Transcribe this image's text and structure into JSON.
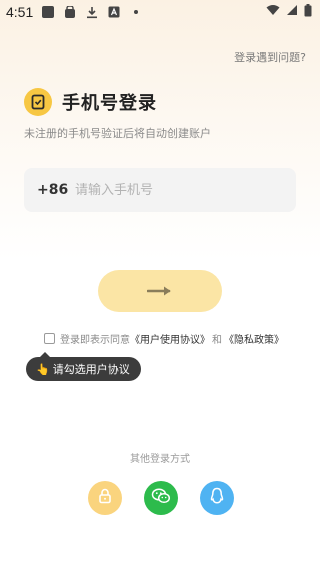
{
  "status_bar": {
    "time": "4:51",
    "icons": [
      "app-icon",
      "lock-app-icon",
      "download-icon",
      "font-app-icon",
      "dot-icon",
      "wifi-icon",
      "signal-icon",
      "battery-icon"
    ]
  },
  "header": {
    "help_link": "登录遇到问题?"
  },
  "title": {
    "text": "手机号登录",
    "logo_icon": "phone-check-icon"
  },
  "subtitle": "未注册的手机号验证后将自动创建账户",
  "phone": {
    "country_code": "+86",
    "placeholder": "请输入手机号",
    "value": ""
  },
  "submit": {
    "icon": "arrow-right-icon",
    "color": "#fbe5a5",
    "arrow_color": "#8a7d5a"
  },
  "agreement": {
    "checked": false,
    "prefix": "登录即表示同意",
    "user_agreement": "《用户使用协议》",
    "and": "和",
    "privacy_policy": "《隐私政策》"
  },
  "tooltip": {
    "icon": "pointing-hand-icon",
    "text": "请勾选用户协议"
  },
  "other_login": {
    "label": "其他登录方式",
    "methods": [
      {
        "name": "password",
        "icon": "lock-icon",
        "color": "#fad47e"
      },
      {
        "name": "wechat",
        "icon": "wechat-icon",
        "color": "#2dbb4c"
      },
      {
        "name": "qq",
        "icon": "qq-icon",
        "color": "#4fb3f2"
      }
    ]
  }
}
